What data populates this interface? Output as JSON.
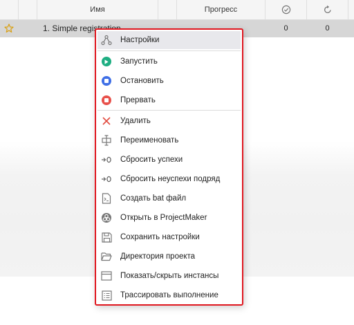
{
  "colors": {
    "run": "#1eae82",
    "stop": "#3f6fe6",
    "abort": "#e8514b",
    "delete": "#e24b3f",
    "menu_border": "#e0161e",
    "row_selected": "#d6d6d6"
  },
  "table": {
    "columns": {
      "name": "Имя",
      "progress": "Прогресс",
      "success_icon": "check-circle-icon",
      "retry_icon": "refresh-icon"
    },
    "rows": [
      {
        "star_icon": "star-icon",
        "name": "1. Simple registration",
        "success": "0",
        "retries": "0"
      }
    ]
  },
  "context_menu": {
    "items": [
      {
        "label": "Настройки",
        "icon": "settings-nodes-icon"
      },
      {
        "label": "Запустить",
        "icon": "play-icon"
      },
      {
        "label": "Остановить",
        "icon": "stop-icon"
      },
      {
        "label": "Прервать",
        "icon": "abort-icon"
      },
      {
        "label": "Удалить",
        "icon": "delete-icon"
      },
      {
        "label": "Переименовать",
        "icon": "rename-icon"
      },
      {
        "label": "Сбросить успехи",
        "icon": "reset-icon"
      },
      {
        "label": "Сбросить неуспехи подряд",
        "icon": "reset-icon"
      },
      {
        "label": "Создать bat файл",
        "icon": "bat-file-icon"
      },
      {
        "label": "Открыть в ProjectMaker",
        "icon": "projectmaker-icon"
      },
      {
        "label": "Сохранить настройки",
        "icon": "save-icon"
      },
      {
        "label": "Директория проекта",
        "icon": "folder-icon"
      },
      {
        "label": "Показать/скрыть инстансы",
        "icon": "window-icon"
      },
      {
        "label": "Трассировать выполнение",
        "icon": "trace-list-icon"
      }
    ]
  }
}
